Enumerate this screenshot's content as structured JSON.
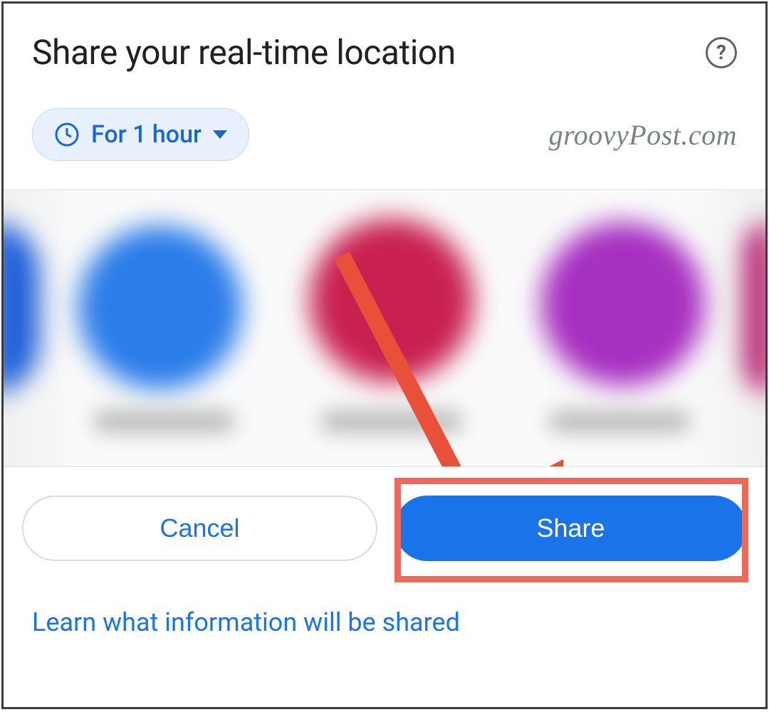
{
  "header": {
    "title": "Share your real-time location",
    "help_aria": "Help"
  },
  "duration": {
    "label": "For 1 hour"
  },
  "watermark": "groovyPost.com",
  "buttons": {
    "cancel": "Cancel",
    "share": "Share"
  },
  "footer": {
    "learn_link": "Learn what information will be shared"
  }
}
